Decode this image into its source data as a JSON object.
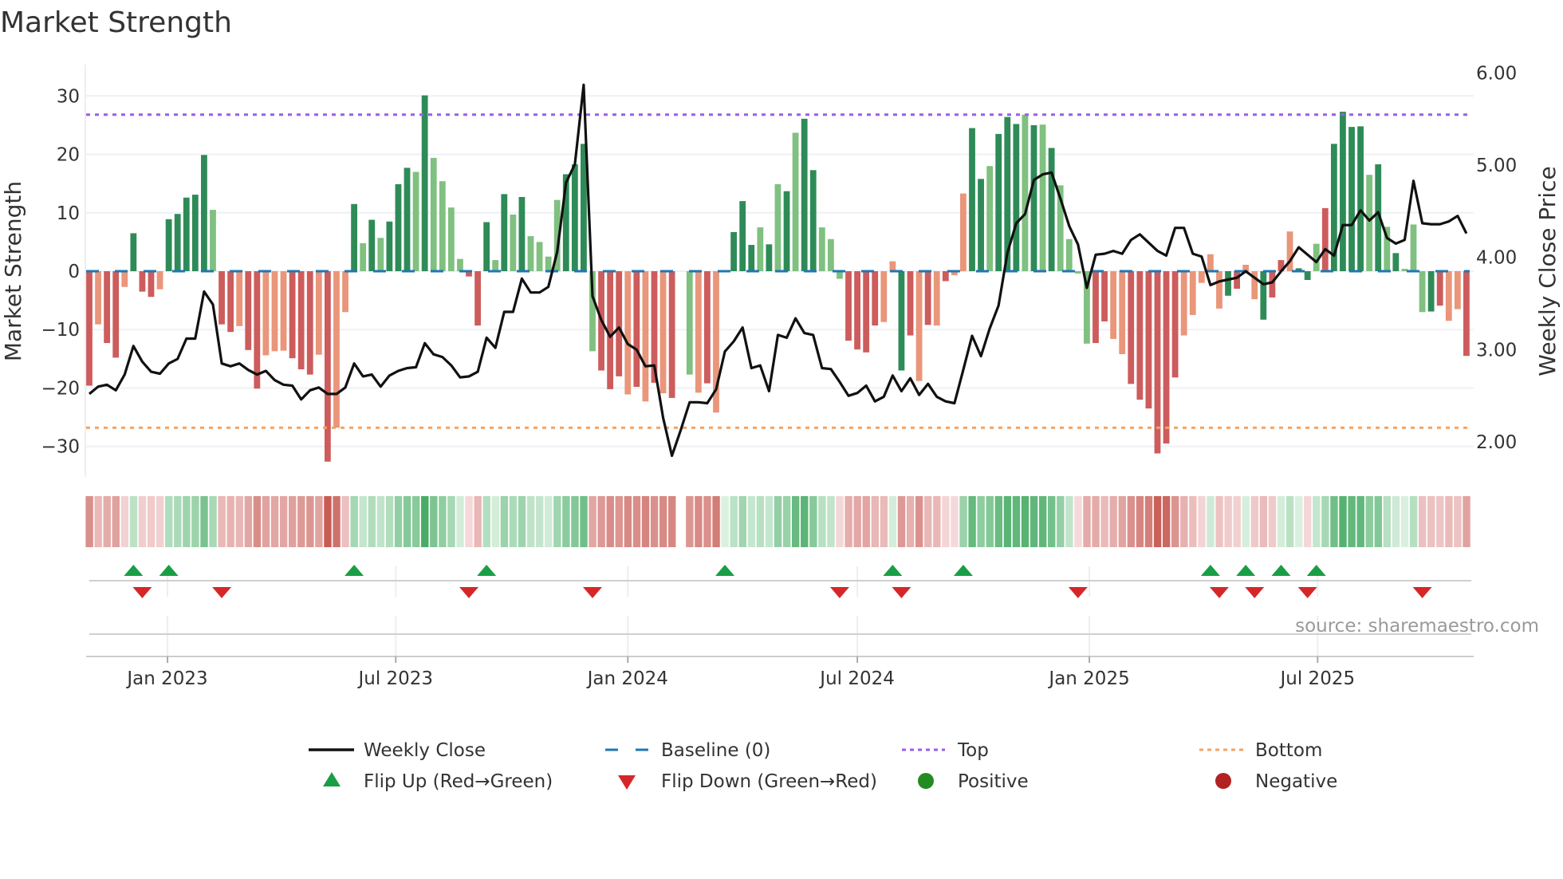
{
  "chart_data": {
    "type": "bar",
    "title": "Market Strength",
    "ylabel": "Market Strength",
    "y2label": "Weekly Close Price",
    "ylim": [
      -35.3,
      35.3
    ],
    "y2lim": [
      1.62,
      6.09
    ],
    "yticks": [
      30,
      20,
      10,
      0,
      -10,
      -20,
      -30
    ],
    "ytick_labels": [
      "30",
      "20",
      "10",
      "0",
      "−10",
      "−20",
      "−30"
    ],
    "y2ticks": [
      6,
      5,
      4,
      3,
      2
    ],
    "y2tick_labels": [
      "6.00",
      "5.00",
      "4.00",
      "3.00",
      "2.00"
    ],
    "start_week": "2022-10-31",
    "frequency": "weekly",
    "x_ticks": [
      {
        "label": "Jan 2023",
        "date": "2023-01-01"
      },
      {
        "label": "Jul 2023",
        "date": "2023-07-01"
      },
      {
        "label": "Jan 2024",
        "date": "2024-01-01"
      },
      {
        "label": "Jul 2024",
        "date": "2024-07-01"
      },
      {
        "label": "Jan 2025",
        "date": "2025-01-01"
      },
      {
        "label": "Jul 2025",
        "date": "2025-07-01"
      }
    ],
    "top_level": 26.8,
    "bottom_level": -26.8,
    "baseline": 0,
    "strength": [
      -19.6,
      -9.1,
      -12.3,
      -14.8,
      -2.7,
      6.5,
      -3.5,
      -4.4,
      -3.1,
      8.9,
      9.8,
      12.6,
      13.1,
      19.9,
      10.5,
      -9.1,
      -10.4,
      -9.4,
      -13.5,
      -20.1,
      -14.4,
      -13.7,
      -13.6,
      -14.9,
      -16.8,
      -17.7,
      -14.3,
      -32.6,
      -26.8,
      -7.0,
      11.5,
      4.8,
      8.8,
      5.7,
      8.5,
      14.9,
      17.7,
      17.0,
      30.1,
      19.4,
      15.4,
      10.9,
      2.1,
      -0.9,
      -9.3,
      8.4,
      1.9,
      13.2,
      9.7,
      12.7,
      6.0,
      5.0,
      2.5,
      12.2,
      16.6,
      18.3,
      21.8,
      -13.7,
      -17.0,
      -20.2,
      -18.0,
      -21.1,
      -19.8,
      -22.3,
      -19.1,
      -20.9,
      -21.7,
      null,
      -17.7,
      -20.8,
      -19.2,
      -24.2,
      0.2,
      6.7,
      12.0,
      4.5,
      7.5,
      4.6,
      14.9,
      13.7,
      23.7,
      26.1,
      17.3,
      7.5,
      5.5,
      -1.3,
      -11.9,
      -13.4,
      -13.9,
      -9.3,
      -8.7,
      1.7,
      -17.0,
      -11.0,
      -18.8,
      -9.2,
      -9.3,
      -1.7,
      -0.7,
      13.3,
      24.5,
      15.8,
      18.0,
      23.5,
      26.4,
      25.2,
      26.8,
      25.0,
      25.1,
      21.1,
      14.7,
      5.5,
      -0.4,
      -12.4,
      -12.3,
      -8.6,
      -11.6,
      -14.2,
      -19.3,
      -22.0,
      -23.5,
      -31.2,
      -29.5,
      -18.2,
      -11.0,
      -7.5,
      -2.0,
      2.9,
      -6.4,
      -4.2,
      -3.0,
      1.1,
      -4.8,
      -8.3,
      -4.5,
      1.9,
      6.8,
      0.5,
      -1.5,
      4.7,
      10.8,
      21.8,
      27.3,
      24.7,
      24.8,
      16.5,
      18.3,
      7.6,
      3.1,
      0.4,
      8.0,
      -7.0,
      -6.9,
      -5.9,
      -8.5,
      -6.5,
      -14.5
    ],
    "tone": "RrRRrGRRrGGGGGgRRrRRrrrRRRrRrrGgGgGGGgGgggsRRGgGgGggggGGGgRRRrRrRrRRxrRrRGGGgGgGgGGgggRRRRrrGRrRrRrrGGgGGGgGgGggggRRrrRRRRRRrrrrrGRrrGRRrGGgRGGGGgGgGgggGRrrRr",
    "weekly_close": [
      2.52,
      2.6,
      2.62,
      2.56,
      2.73,
      3.04,
      2.87,
      2.76,
      2.74,
      2.85,
      2.9,
      3.12,
      3.12,
      3.63,
      3.49,
      2.85,
      2.82,
      2.85,
      2.78,
      2.73,
      2.77,
      2.67,
      2.62,
      2.61,
      2.46,
      2.56,
      2.59,
      2.52,
      2.52,
      2.59,
      2.85,
      2.71,
      2.73,
      2.6,
      2.72,
      2.77,
      2.8,
      2.81,
      3.07,
      2.95,
      2.92,
      2.83,
      2.7,
      2.71,
      2.76,
      3.13,
      3.02,
      3.41,
      3.41,
      3.77,
      3.62,
      3.62,
      3.68,
      4.06,
      4.81,
      5.01,
      5.87,
      3.58,
      3.32,
      3.14,
      3.24,
      3.06,
      3.0,
      2.82,
      2.83,
      2.26,
      1.85,
      2.13,
      2.43,
      2.43,
      2.42,
      2.57,
      2.98,
      3.09,
      3.24,
      2.8,
      2.83,
      2.55,
      3.16,
      3.13,
      3.34,
      3.18,
      3.16,
      2.8,
      2.79,
      2.65,
      2.5,
      2.53,
      2.61,
      2.44,
      2.49,
      2.72,
      2.55,
      2.69,
      2.51,
      2.63,
      2.49,
      2.44,
      2.42,
      2.78,
      3.15,
      2.93,
      3.23,
      3.48,
      4.05,
      4.37,
      4.47,
      4.84,
      4.9,
      4.92,
      4.64,
      4.34,
      4.14,
      3.67,
      4.03,
      4.04,
      4.07,
      4.04,
      4.19,
      4.25,
      4.16,
      4.07,
      4.02,
      4.32,
      4.32,
      4.04,
      4.01,
      3.7,
      3.74,
      3.76,
      3.78,
      3.85,
      3.78,
      3.71,
      3.73,
      3.85,
      3.96,
      4.11,
      4.03,
      3.95,
      4.09,
      4.02,
      4.35,
      4.35,
      4.51,
      4.4,
      4.49,
      4.21,
      4.15,
      4.19,
      4.83,
      4.37,
      4.36,
      4.36,
      4.39,
      4.45,
      4.26
    ],
    "flip_up_weeks": [
      6,
      10,
      31,
      46,
      73,
      92,
      100,
      128,
      132,
      136,
      140
    ],
    "flip_down_weeks": [
      7,
      16,
      44,
      58,
      86,
      93,
      113,
      129,
      133,
      139,
      152
    ],
    "legend": {
      "placement": "bottom",
      "entries": [
        "Weekly Close",
        "Baseline (0)",
        "Top",
        "Bottom",
        "Flip Up (Red→Green)",
        "Flip Down (Green→Red)",
        "Positive",
        "Negative"
      ]
    },
    "source": "source: sharemaestro.com"
  },
  "colors": {
    "strong_pos": "#2e8b57",
    "weak_pos": "#80c080",
    "strong_neg": "#cd5c5c",
    "weak_neg": "#e9967a",
    "close_line": "#111111",
    "baseline": "#1f77b4",
    "top": "#9b5de5",
    "bottom": "#f4a261",
    "flip_up": "#1a9e45",
    "flip_down": "#d62728",
    "positive": "#228b22",
    "negative": "#b22222"
  }
}
